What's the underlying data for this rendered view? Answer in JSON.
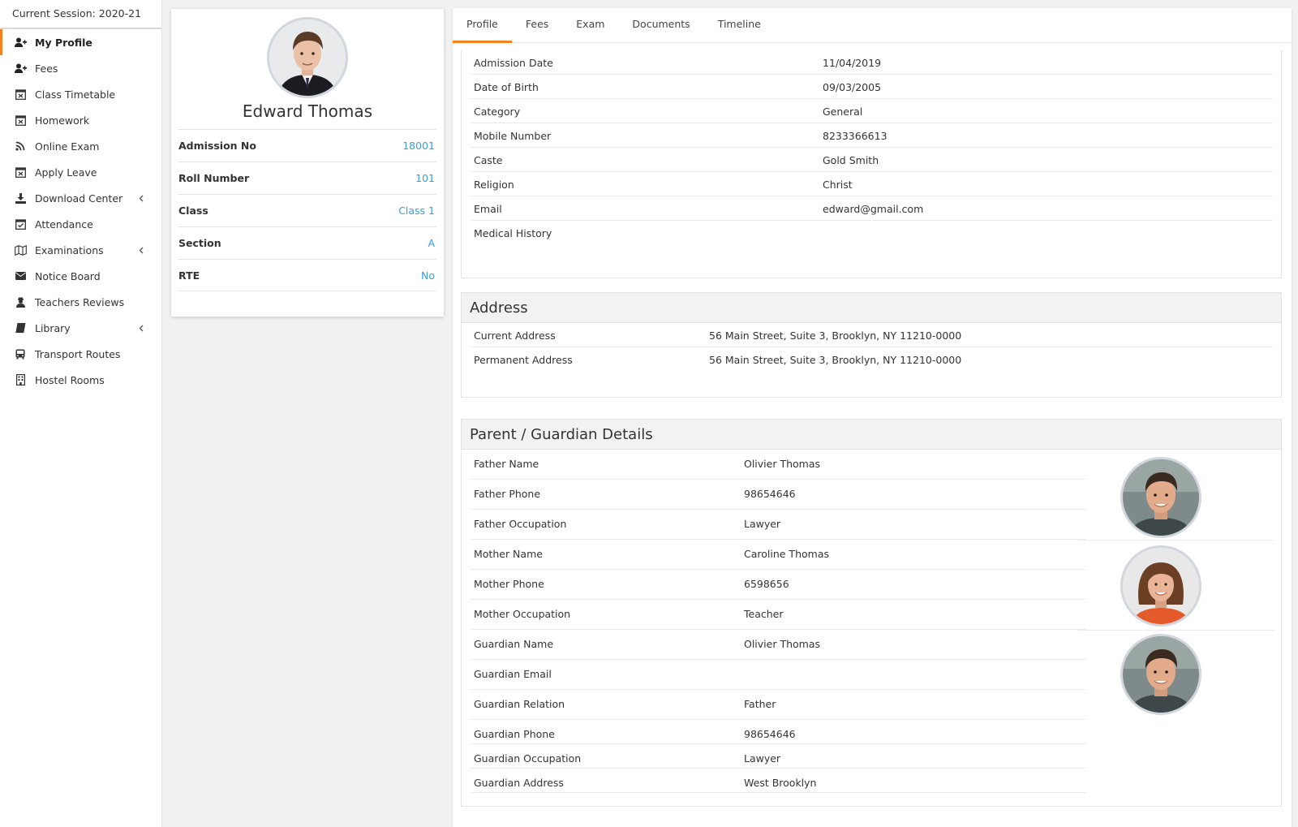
{
  "sidebar": {
    "session": "Current Session: 2020-21",
    "items": [
      {
        "label": "My Profile",
        "icon": "user-plus-icon"
      },
      {
        "label": "Fees",
        "icon": "user-plus-icon"
      },
      {
        "label": "Class Timetable",
        "icon": "calendar-x-icon"
      },
      {
        "label": "Homework",
        "icon": "calendar-x-icon"
      },
      {
        "label": "Online Exam",
        "icon": "rss-icon"
      },
      {
        "label": "Apply Leave",
        "icon": "calendar-x-icon"
      },
      {
        "label": "Download Center",
        "icon": "download-icon"
      },
      {
        "label": "Attendance",
        "icon": "calendar-check-icon"
      },
      {
        "label": "Examinations",
        "icon": "map-icon"
      },
      {
        "label": "Notice Board",
        "icon": "envelope-icon"
      },
      {
        "label": "Teachers Reviews",
        "icon": "user-secret-icon"
      },
      {
        "label": "Library",
        "icon": "book-icon"
      },
      {
        "label": "Transport Routes",
        "icon": "bus-icon"
      },
      {
        "label": "Hostel Rooms",
        "icon": "building-icon"
      }
    ]
  },
  "profile": {
    "name": "Edward Thomas",
    "fields": [
      {
        "label": "Admission No",
        "value": "18001"
      },
      {
        "label": "Roll Number",
        "value": "101"
      },
      {
        "label": "Class",
        "value": "Class 1"
      },
      {
        "label": "Section",
        "value": "A"
      },
      {
        "label": "RTE",
        "value": "No"
      }
    ]
  },
  "tabs": [
    "Profile",
    "Fees",
    "Exam",
    "Documents",
    "Timeline"
  ],
  "details": [
    {
      "label": "Admission Date",
      "value": "11/04/2019"
    },
    {
      "label": "Date of Birth",
      "value": "09/03/2005"
    },
    {
      "label": "Category",
      "value": "General"
    },
    {
      "label": "Mobile Number",
      "value": "8233366613"
    },
    {
      "label": "Caste",
      "value": "Gold Smith"
    },
    {
      "label": "Religion",
      "value": "Christ"
    },
    {
      "label": "Email",
      "value": "edward@gmail.com"
    },
    {
      "label": "Medical History",
      "value": ""
    }
  ],
  "address": {
    "title": "Address",
    "rows": [
      {
        "label": "Current Address",
        "value": "56 Main Street, Suite 3, Brooklyn, NY 11210-0000"
      },
      {
        "label": "Permanent Address",
        "value": "56 Main Street, Suite 3, Brooklyn, NY 11210-0000"
      }
    ]
  },
  "guardian": {
    "title": "Parent / Guardian Details",
    "rows": [
      {
        "label": "Father Name",
        "value": "Olivier Thomas"
      },
      {
        "label": "Father Phone",
        "value": "98654646"
      },
      {
        "label": "Father Occupation",
        "value": "Lawyer"
      },
      {
        "label": "Mother Name",
        "value": "Caroline Thomas"
      },
      {
        "label": "Mother Phone",
        "value": "6598656"
      },
      {
        "label": "Mother Occupation",
        "value": "Teacher"
      },
      {
        "label": "Guardian Name",
        "value": "Olivier Thomas"
      },
      {
        "label": "Guardian Email",
        "value": ""
      },
      {
        "label": "Guardian Relation",
        "value": "Father"
      },
      {
        "label": "Guardian Phone",
        "value": "98654646"
      },
      {
        "label": "Guardian Occupation",
        "value": "Lawyer"
      },
      {
        "label": "Guardian Address",
        "value": "West Brooklyn"
      }
    ]
  },
  "colors": {
    "accent": "#f58220",
    "link": "#3c9dd6"
  }
}
